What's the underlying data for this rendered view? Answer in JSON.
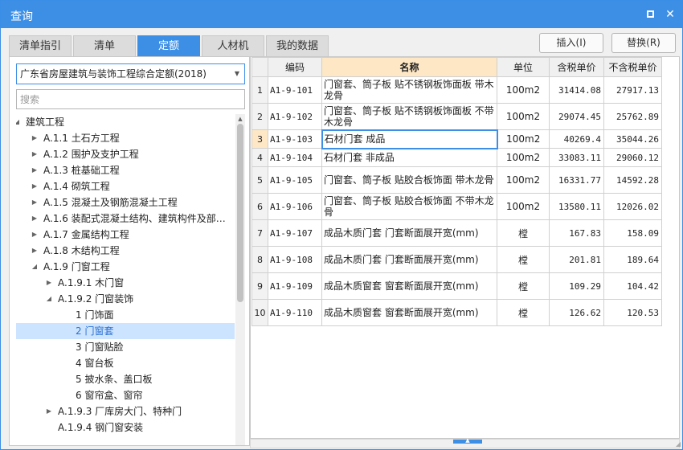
{
  "window": {
    "title": "查询",
    "restore_icon": "restore-icon",
    "close_icon": "close-icon"
  },
  "tabs": [
    {
      "label": "清单指引"
    },
    {
      "label": "清单"
    },
    {
      "label": "定额",
      "active": true
    },
    {
      "label": "人材机"
    },
    {
      "label": "我的数据"
    }
  ],
  "buttons": {
    "insert": "插入(I)",
    "replace": "替换(R)"
  },
  "left": {
    "quota_library": "广东省房屋建筑与装饰工程综合定额(2018)",
    "search_placeholder": "搜索",
    "tree": [
      {
        "label": "建筑工程",
        "level": 0,
        "toggle": "expanded"
      },
      {
        "label": "A.1.1 土石方工程",
        "level": 1,
        "toggle": "collapsed"
      },
      {
        "label": "A.1.2 围护及支护工程",
        "level": 1,
        "toggle": "collapsed"
      },
      {
        "label": "A.1.3 桩基础工程",
        "level": 1,
        "toggle": "collapsed"
      },
      {
        "label": "A.1.4 砌筑工程",
        "level": 1,
        "toggle": "collapsed"
      },
      {
        "label": "A.1.5 混凝土及钢筋混凝土工程",
        "level": 1,
        "toggle": "collapsed"
      },
      {
        "label": "A.1.6 装配式混凝土结构、建筑构件及部…",
        "level": 1,
        "toggle": "collapsed"
      },
      {
        "label": "A.1.7 金属结构工程",
        "level": 1,
        "toggle": "collapsed"
      },
      {
        "label": "A.1.8 木结构工程",
        "level": 1,
        "toggle": "collapsed"
      },
      {
        "label": "A.1.9 门窗工程",
        "level": 1,
        "toggle": "expanded"
      },
      {
        "label": "A.1.9.1 木门窗",
        "level": 2,
        "toggle": "collapsed"
      },
      {
        "label": "A.1.9.2 门窗装饰",
        "level": 2,
        "toggle": "expanded"
      },
      {
        "label": "1 门饰面",
        "level": 3,
        "toggle": "none"
      },
      {
        "label": "2 门窗套",
        "level": 3,
        "toggle": "none",
        "selected": true
      },
      {
        "label": "3 门窗贴脸",
        "level": 3,
        "toggle": "none"
      },
      {
        "label": "4 窗台板",
        "level": 3,
        "toggle": "none"
      },
      {
        "label": "5 披水条、盖口板",
        "level": 3,
        "toggle": "none"
      },
      {
        "label": "6 窗帘盒、窗帘",
        "level": 3,
        "toggle": "none"
      },
      {
        "label": "A.1.9.3 厂库房大门、特种门",
        "level": 2,
        "toggle": "collapsed"
      },
      {
        "label": "A.1.9.4 钢门窗安装",
        "level": 2,
        "toggle": "none"
      }
    ]
  },
  "table": {
    "headers": [
      "",
      "编码",
      "名称",
      "单位",
      "含税单价",
      "不含税单价"
    ],
    "rows": [
      {
        "idx": "1",
        "code": "A1-9-101",
        "name": "门窗套、筒子板 贴不锈钢板饰面板 带木龙骨",
        "unit": "100m2",
        "price_tax": "31414.08",
        "price_notax": "27917.13"
      },
      {
        "idx": "2",
        "code": "A1-9-102",
        "name": "门窗套、筒子板 贴不锈钢板饰面板 不带木龙骨",
        "unit": "100m2",
        "price_tax": "29074.45",
        "price_notax": "25762.89"
      },
      {
        "idx": "3",
        "code": "A1-9-103",
        "name": "石材门套 成品",
        "unit": "100m2",
        "price_tax": "40269.4",
        "price_notax": "35044.26",
        "current": true
      },
      {
        "idx": "4",
        "code": "A1-9-104",
        "name": "石材门套 非成品",
        "unit": "100m2",
        "price_tax": "33083.11",
        "price_notax": "29060.12"
      },
      {
        "idx": "5",
        "code": "A1-9-105",
        "name": "门窗套、筒子板 贴胶合板饰面 带木龙骨",
        "unit": "100m2",
        "price_tax": "16331.77",
        "price_notax": "14592.28"
      },
      {
        "idx": "6",
        "code": "A1-9-106",
        "name": "门窗套、筒子板 贴胶合板饰面 不带木龙骨",
        "unit": "100m2",
        "price_tax": "13580.11",
        "price_notax": "12026.02"
      },
      {
        "idx": "7",
        "code": "A1-9-107",
        "name": "成品木质门套 门套断面展开宽(mm)",
        "unit": "樘",
        "price_tax": "167.83",
        "price_notax": "158.09"
      },
      {
        "idx": "8",
        "code": "A1-9-108",
        "name": "成品木质门套 门套断面展开宽(mm)",
        "unit": "樘",
        "price_tax": "201.81",
        "price_notax": "189.64"
      },
      {
        "idx": "9",
        "code": "A1-9-109",
        "name": "成品木质窗套 窗套断面展开宽(mm)",
        "unit": "樘",
        "price_tax": "109.29",
        "price_notax": "104.42"
      },
      {
        "idx": "10",
        "code": "A1-9-110",
        "name": "成品木质窗套 窗套断面展开宽(mm)",
        "unit": "樘",
        "price_tax": "126.62",
        "price_notax": "120.53"
      }
    ]
  }
}
